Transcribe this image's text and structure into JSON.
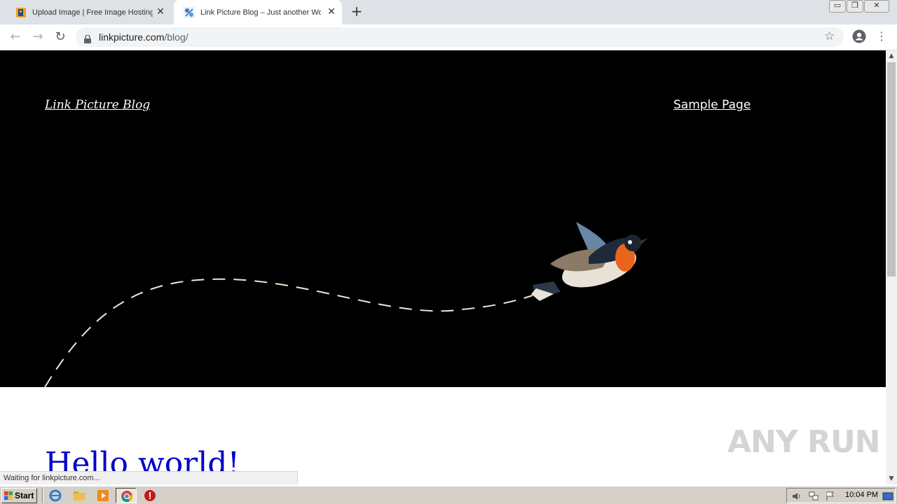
{
  "browser": {
    "tabs": [
      {
        "title": "Upload Image | Free Image Hosting |",
        "active": false
      },
      {
        "title": "Link Picture Blog – Just another Wor",
        "active": true
      }
    ],
    "url": {
      "host": "linkpicture.com",
      "path": "/blog/"
    },
    "status": "Waiting for linkpicture.com..."
  },
  "page": {
    "site_title": "Link Picture Blog",
    "nav": [
      "Sample Page"
    ],
    "post_title": "Hello world!"
  },
  "watermark": "ANY RUN",
  "taskbar": {
    "start_label": "Start",
    "clock": "10:04 PM"
  },
  "colors": {
    "hero_bg": "#000000",
    "post_title": "#0000c8",
    "tab_strip": "#dee1e6"
  }
}
